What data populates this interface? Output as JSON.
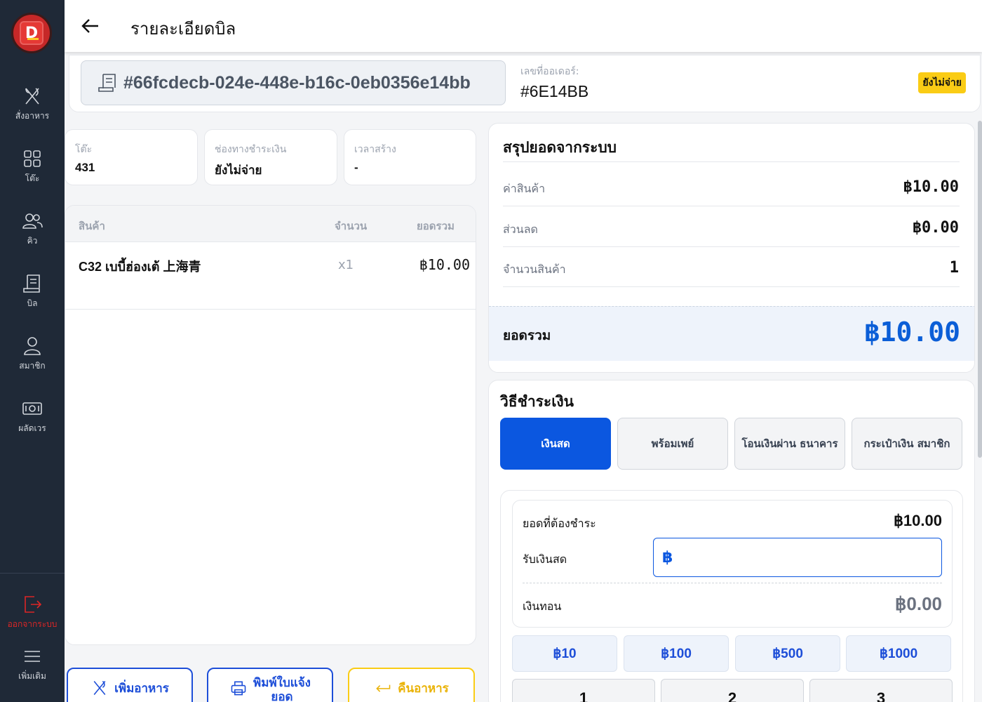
{
  "sidebar": {
    "items": [
      {
        "label": "สั่งอาหาร",
        "icon": "utensils-icon"
      },
      {
        "label": "โต๊ะ",
        "icon": "grid-icon"
      },
      {
        "label": "คิว",
        "icon": "users-icon"
      },
      {
        "label": "บิล",
        "icon": "receipt-icon"
      },
      {
        "label": "สมาชิก",
        "icon": "user-icon"
      },
      {
        "label": "ผลัดเวร",
        "icon": "cash-icon"
      }
    ],
    "logout_label": "ออกจากระบบ",
    "more_label": "เพิ่มเติม"
  },
  "header": {
    "title": "รายละเอียดบิล"
  },
  "order": {
    "bill_id": "#66fcdecb-024e-448e-b16c-0eb0356e14bb",
    "order_no_label": "เลขที่ออเดอร์:",
    "order_no": "#6E14BB",
    "status": "ยังไม่จ่าย"
  },
  "info": {
    "table_label": "โต๊ะ",
    "table_value": "431",
    "channel_label": "ช่องทางชำระเงิน",
    "channel_value": "ยังไม่จ่าย",
    "time_label": "เวลาสร้าง",
    "time_value": "-"
  },
  "items_table": {
    "headers": {
      "product": "สินค้า",
      "qty": "จำนวน",
      "total": "ยอดรวม"
    },
    "rows": [
      {
        "name": "C32 เบบี้ฮ่องเต้ 上海青",
        "qty": "x1",
        "total": "฿10.00"
      }
    ]
  },
  "actions": {
    "add_food": "เพิ่มอาหาร",
    "print_line1": "พิมพ์ใบแจ้ง",
    "print_line2": "ยอด",
    "return_food": "คืนอาหาร"
  },
  "summary": {
    "title": "สรุปยอดจากระบบ",
    "subtotal_label": "ค่าสินค้า",
    "subtotal": "฿10.00",
    "discount_label": "ส่วนลด",
    "discount": "฿0.00",
    "count_label": "จำนวนสินค้า",
    "count": "1",
    "total_label": "ยอดรวม",
    "total": "฿10.00"
  },
  "payment": {
    "title": "วิธีชำระเงิน",
    "methods": [
      {
        "label": "เงินสด"
      },
      {
        "label": "พร้อมเพย์"
      },
      {
        "label": "โอนเงินผ่าน ธนาคาร"
      },
      {
        "label": "กระเป๋าเงิน สมาชิก"
      }
    ],
    "due_label": "ยอดที่ต้องชำระ",
    "due": "฿10.00",
    "received_label": "รับเงินสด",
    "currency_symbol": "฿",
    "received_value": "",
    "change_label": "เงินทอน",
    "change": "฿0.00",
    "quick_amounts": [
      "฿10",
      "฿100",
      "฿500",
      "฿1000"
    ],
    "keypad": [
      "1",
      "2",
      "3"
    ]
  }
}
